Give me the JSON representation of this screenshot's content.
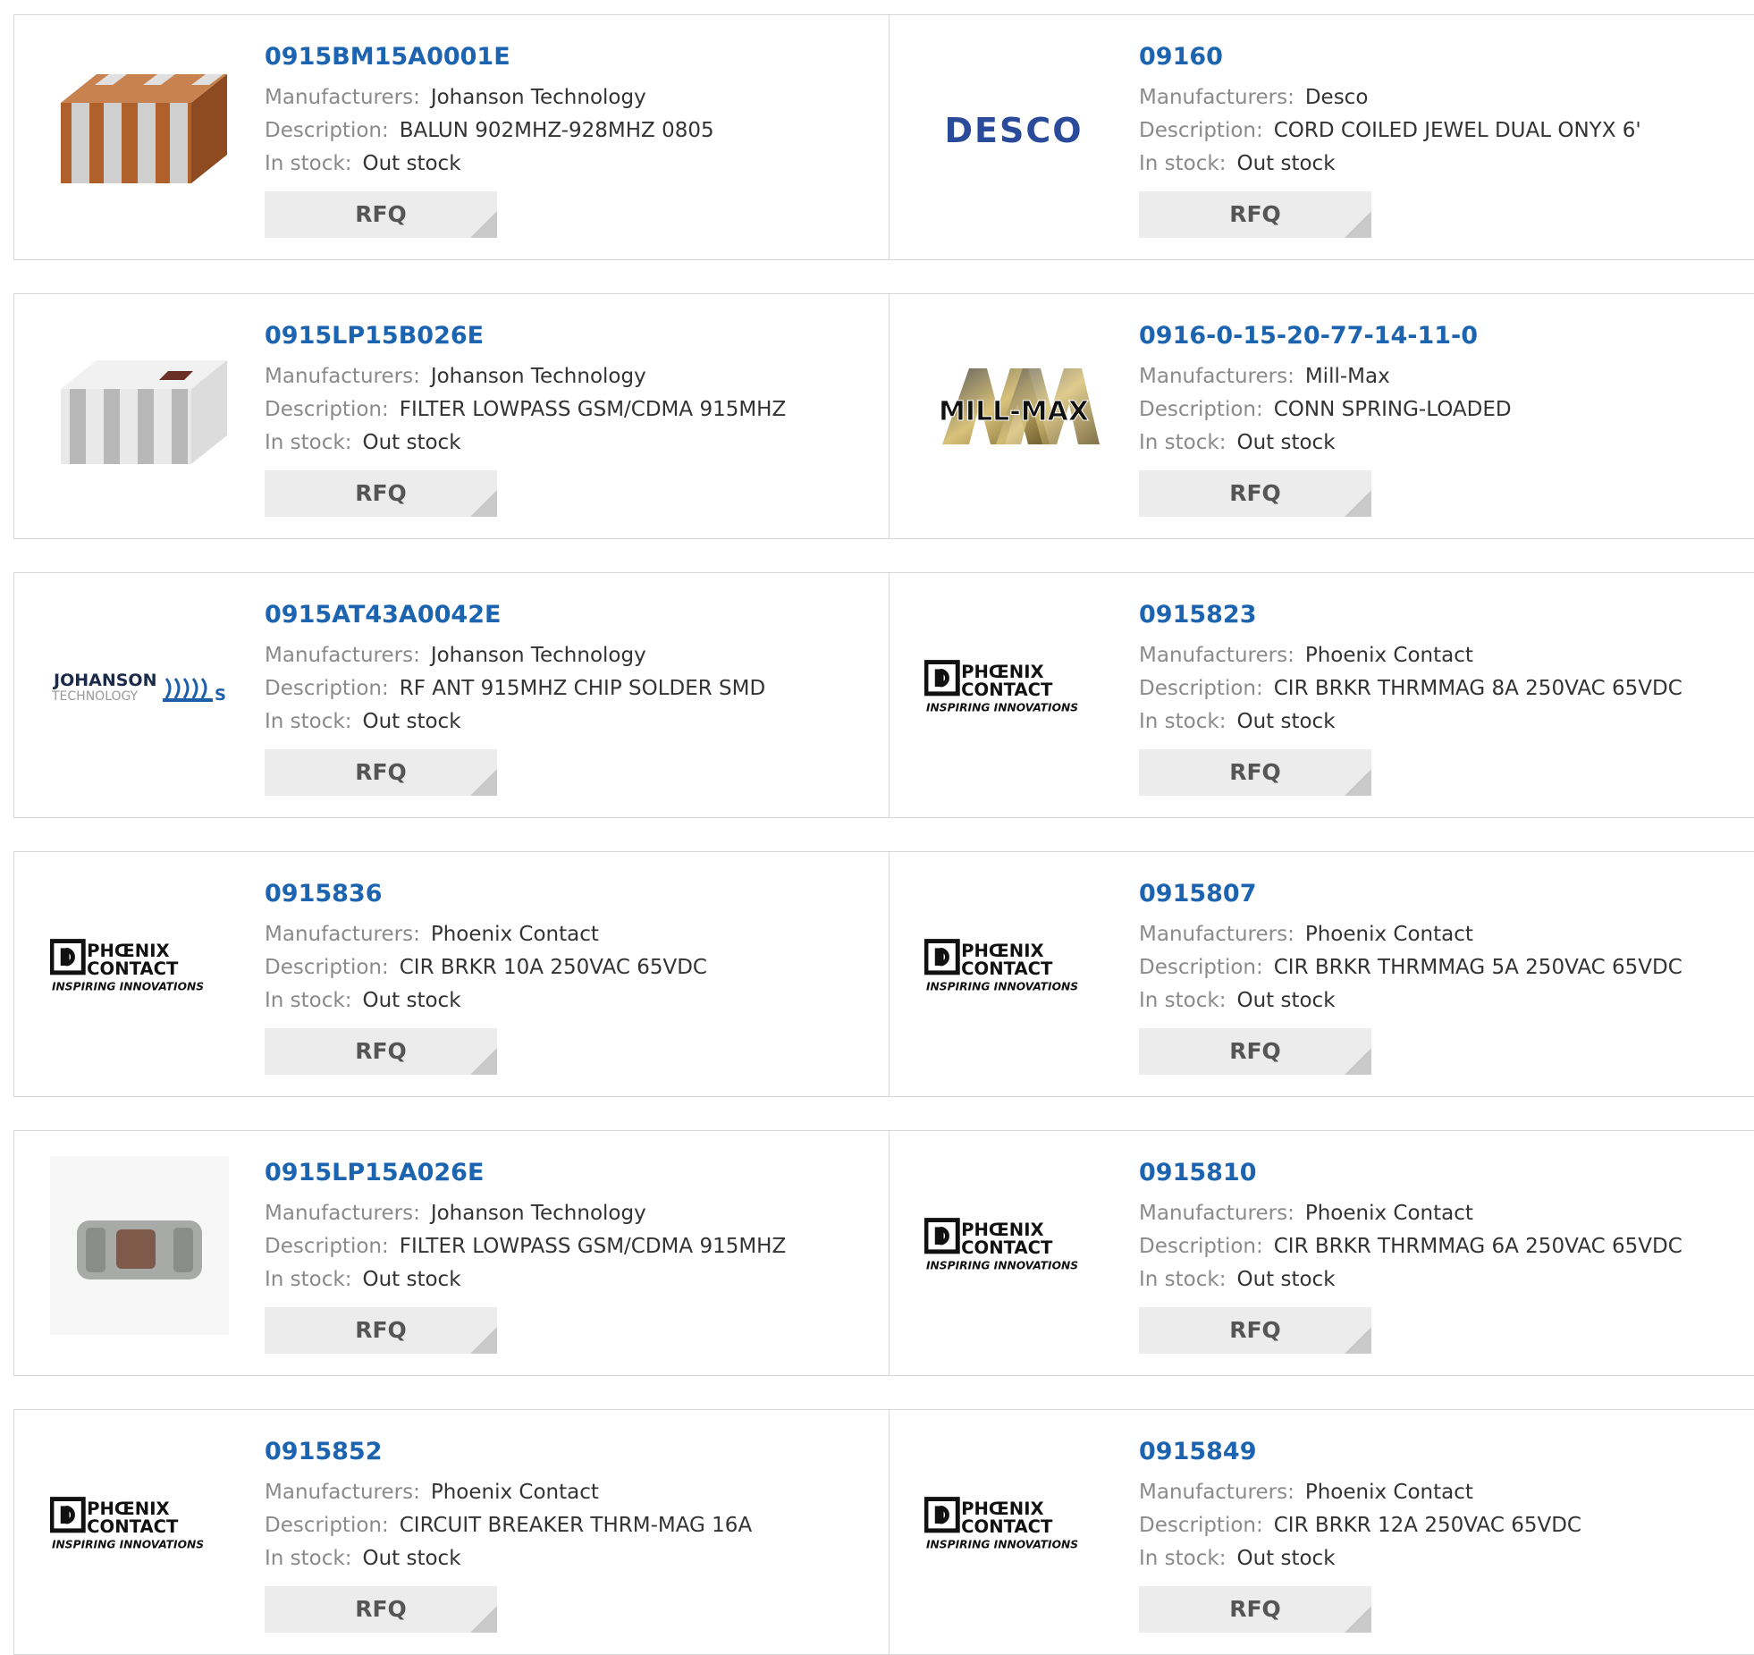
{
  "labels": {
    "manufacturers": "Manufacturers:",
    "description": "Description:",
    "in_stock": "In stock:",
    "rfq": "RFQ"
  },
  "colors": {
    "part_link": "#1d64b0",
    "label": "#8a8a8a",
    "value": "#333333",
    "rfq_bg": "#ececec",
    "border": "#d6d6d6"
  },
  "products": [
    {
      "part_number": "0915BM15A0001E",
      "manufacturer": "Johanson Technology",
      "description": "BALUN 902MHZ-928MHZ 0805",
      "stock": "Out stock",
      "image": "chip-balun-orange"
    },
    {
      "part_number": "09160",
      "manufacturer": "Desco",
      "description": "CORD COILED JEWEL DUAL ONYX 6'",
      "stock": "Out stock",
      "image": "desco-logo",
      "logo_text": "DESCO"
    },
    {
      "part_number": "0915LP15B026E",
      "manufacturer": "Johanson Technology",
      "description": "FILTER LOWPASS GSM/CDMA 915MHZ",
      "stock": "Out stock",
      "image": "chip-filter-white"
    },
    {
      "part_number": "0916-0-15-20-77-14-11-0",
      "manufacturer": "Mill-Max",
      "description": "CONN SPRING-LOADED",
      "stock": "Out stock",
      "image": "millmax-logo",
      "logo_text": "MILL-MAX"
    },
    {
      "part_number": "0915AT43A0042E",
      "manufacturer": "Johanson Technology",
      "description": "RF ANT 915MHZ CHIP SOLDER SMD",
      "stock": "Out stock",
      "image": "johanson-logo",
      "logo_text": "JOHANSON",
      "logo_sub": "TECHNOLOGY"
    },
    {
      "part_number": "0915823",
      "manufacturer": "Phoenix Contact",
      "description": "CIR BRKR THRMMAG 8A 250VAC 65VDC",
      "stock": "Out stock",
      "image": "phoenix-logo"
    },
    {
      "part_number": "0915836",
      "manufacturer": "Phoenix Contact",
      "description": "CIR BRKR 10A 250VAC 65VDC",
      "stock": "Out stock",
      "image": "phoenix-logo"
    },
    {
      "part_number": "0915807",
      "manufacturer": "Phoenix Contact",
      "description": "CIR BRKR THRMMAG 5A 250VAC 65VDC",
      "stock": "Out stock",
      "image": "phoenix-logo"
    },
    {
      "part_number": "0915LP15A026E",
      "manufacturer": "Johanson Technology",
      "description": "FILTER LOWPASS GSM/CDMA 915MHZ",
      "stock": "Out stock",
      "image": "chip-filter-grey"
    },
    {
      "part_number": "0915810",
      "manufacturer": "Phoenix Contact",
      "description": "CIR BRKR THRMMAG 6A 250VAC 65VDC",
      "stock": "Out stock",
      "image": "phoenix-logo"
    },
    {
      "part_number": "0915852",
      "manufacturer": "Phoenix Contact",
      "description": "CIRCUIT BREAKER THRM-MAG 16A",
      "stock": "Out stock",
      "image": "phoenix-logo"
    },
    {
      "part_number": "0915849",
      "manufacturer": "Phoenix Contact",
      "description": "CIR BRKR 12A 250VAC 65VDC",
      "stock": "Out stock",
      "image": "phoenix-logo"
    }
  ],
  "phoenix_logo": {
    "line1": "PHŒNIX",
    "line2": "CONTACT",
    "tagline": "INSPIRING INNOVATIONS"
  }
}
